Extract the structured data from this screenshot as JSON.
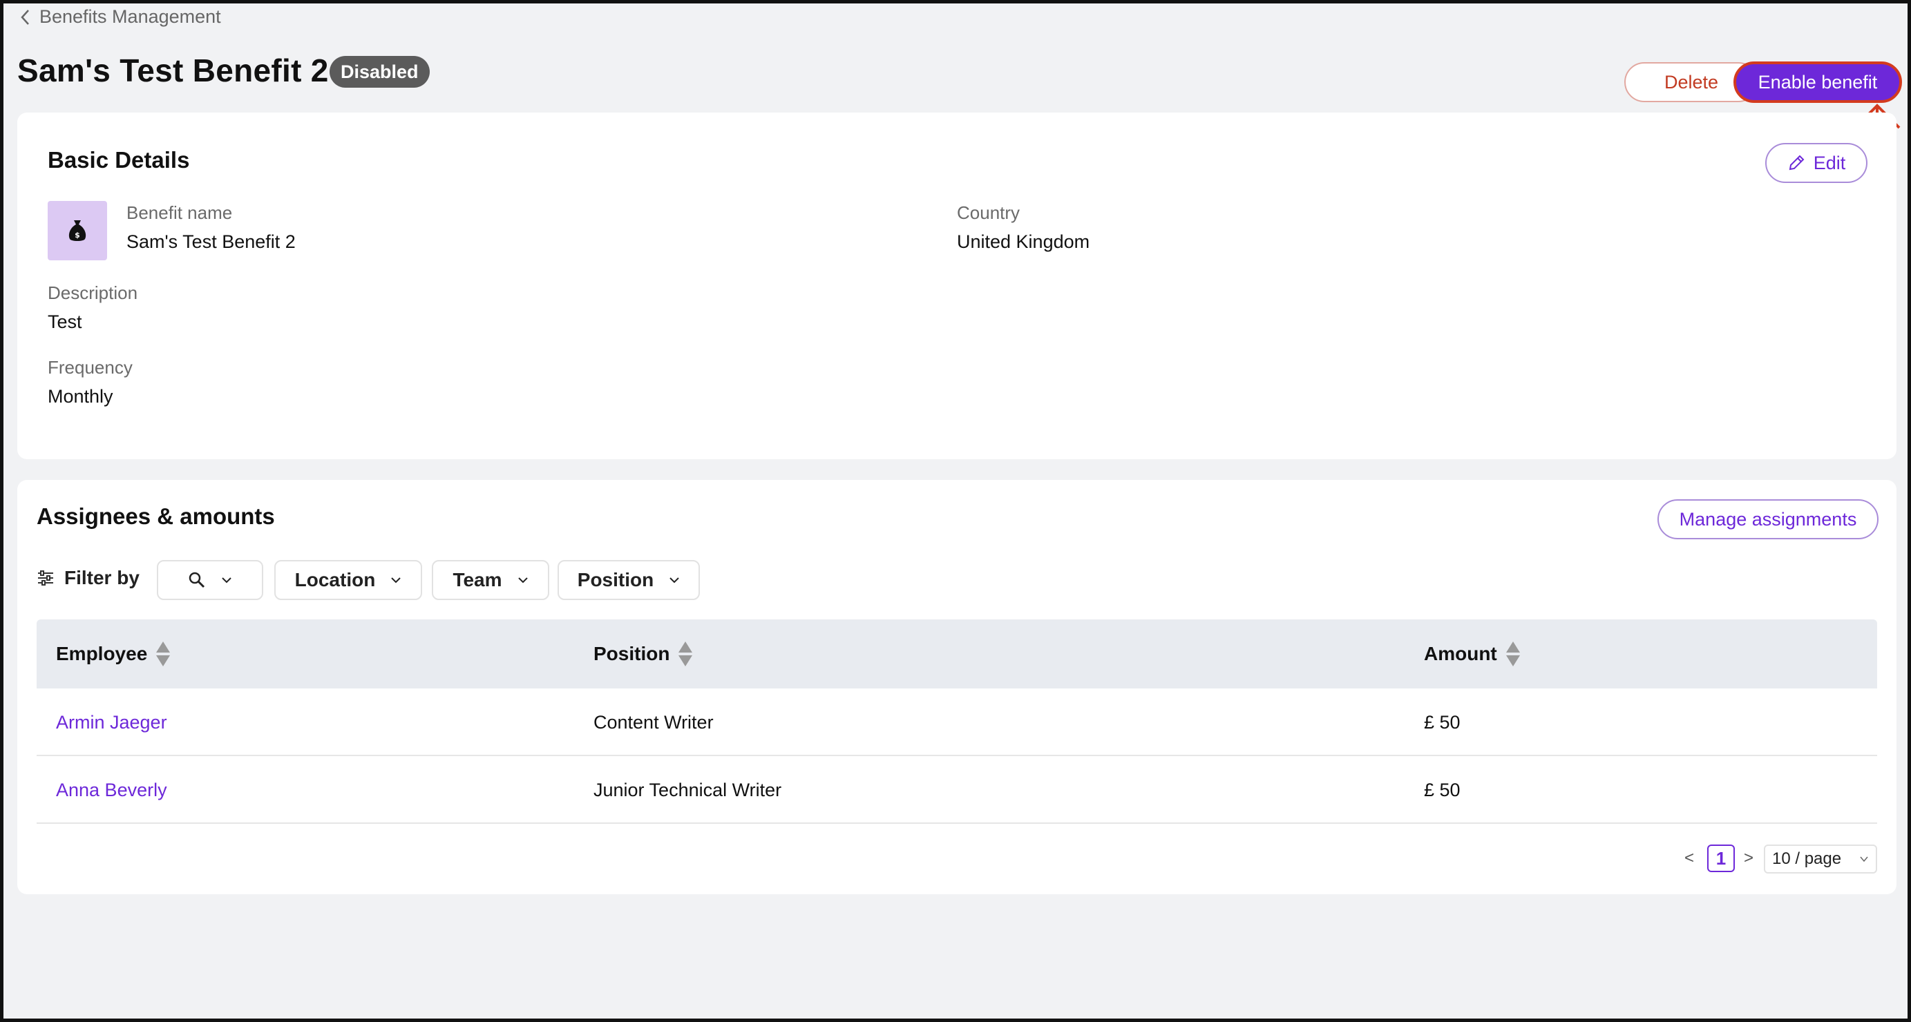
{
  "breadcrumb": {
    "label": "Benefits Management"
  },
  "header": {
    "title": "Sam's Test Benefit 2",
    "status": "Disabled",
    "delete_label": "Delete",
    "enable_label": "Enable benefit"
  },
  "colors": {
    "accent": "#6d28d9",
    "danger": "#c23b22",
    "badge": "#5b5b5b",
    "annotation": "#d33b1f"
  },
  "basic_details": {
    "title": "Basic Details",
    "edit_label": "Edit",
    "icon": "money-bag-icon",
    "fields": {
      "benefit_name": {
        "label": "Benefit name",
        "value": "Sam's Test Benefit 2"
      },
      "country": {
        "label": "Country",
        "value": "United Kingdom"
      },
      "description": {
        "label": "Description",
        "value": "Test"
      },
      "frequency": {
        "label": "Frequency",
        "value": "Monthly"
      }
    }
  },
  "assignees": {
    "title": "Assignees & amounts",
    "manage_label": "Manage assignments",
    "filter": {
      "label": "Filter by",
      "options": [
        "Location",
        "Team",
        "Position"
      ]
    },
    "columns": [
      "Employee",
      "Position",
      "Amount"
    ],
    "rows": [
      {
        "employee": "Armin Jaeger",
        "position": "Content Writer",
        "amount": "£ 50"
      },
      {
        "employee": "Anna Beverly",
        "position": "Junior Technical Writer",
        "amount": "£ 50"
      }
    ],
    "pagination": {
      "prev": "<",
      "current": "1",
      "next": ">",
      "page_size": "10 / page"
    }
  }
}
